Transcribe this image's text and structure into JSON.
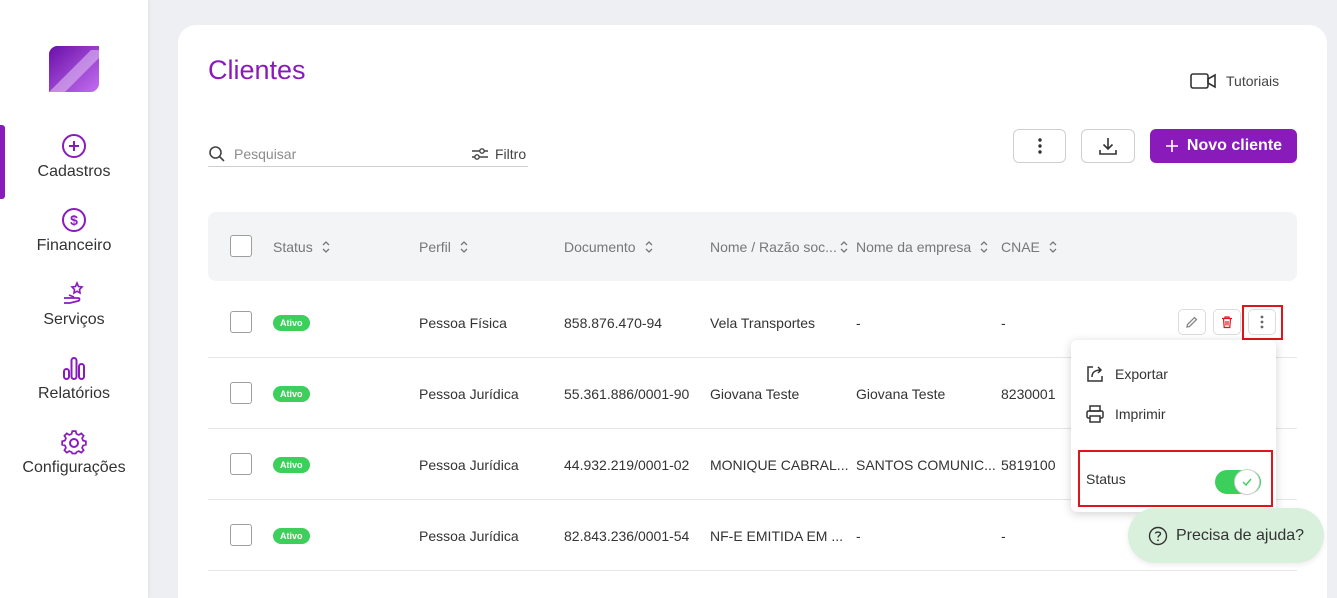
{
  "colors": {
    "brand": "#8a1bbb",
    "status_active": "#3ccf5b",
    "highlight": "#e0141b",
    "help_bg": "#d9f0dc"
  },
  "sidebar": {
    "items": [
      {
        "label": "Cadastros",
        "icon": "plus-circle-icon",
        "active": true
      },
      {
        "label": "Financeiro",
        "icon": "dollar-circle-icon"
      },
      {
        "label": "Serviços",
        "icon": "hand-star-icon"
      },
      {
        "label": "Relatórios",
        "icon": "bar-chart-icon"
      },
      {
        "label": "Configurações",
        "icon": "gear-icon"
      }
    ]
  },
  "header": {
    "title": "Clientes",
    "tutorials_label": "Tutoriais"
  },
  "toolbar": {
    "search_placeholder": "Pesquisar",
    "filter_label": "Filtro",
    "new_client_label": "Novo cliente"
  },
  "table": {
    "columns": [
      "Status",
      "Perfil",
      "Documento",
      "Nome / Razão soc...",
      "Nome da empresa",
      "CNAE"
    ],
    "rows": [
      {
        "status": "Ativo",
        "perfil": "Pessoa Física",
        "documento": "858.876.470-94",
        "nome": "Vela Transportes",
        "empresa": "-",
        "cnae": "-"
      },
      {
        "status": "Ativo",
        "perfil": "Pessoa Jurídica",
        "documento": "55.361.886/0001-90",
        "nome": "Giovana Teste",
        "empresa": "Giovana Teste",
        "cnae": "8230001"
      },
      {
        "status": "Ativo",
        "perfil": "Pessoa Jurídica",
        "documento": "44.932.219/0001-02",
        "nome": "MONIQUE CABRAL...",
        "empresa": "SANTOS COMUNIC...",
        "cnae": "5819100"
      },
      {
        "status": "Ativo",
        "perfil": "Pessoa Jurídica",
        "documento": "82.843.236/0001-54",
        "nome": "NF-E EMITIDA EM ...",
        "empresa": "-",
        "cnae": "-"
      }
    ]
  },
  "row_menu": {
    "export_label": "Exportar",
    "print_label": "Imprimir",
    "status_label": "Status",
    "status_on": true
  },
  "help": {
    "label": "Precisa de ajuda?"
  }
}
